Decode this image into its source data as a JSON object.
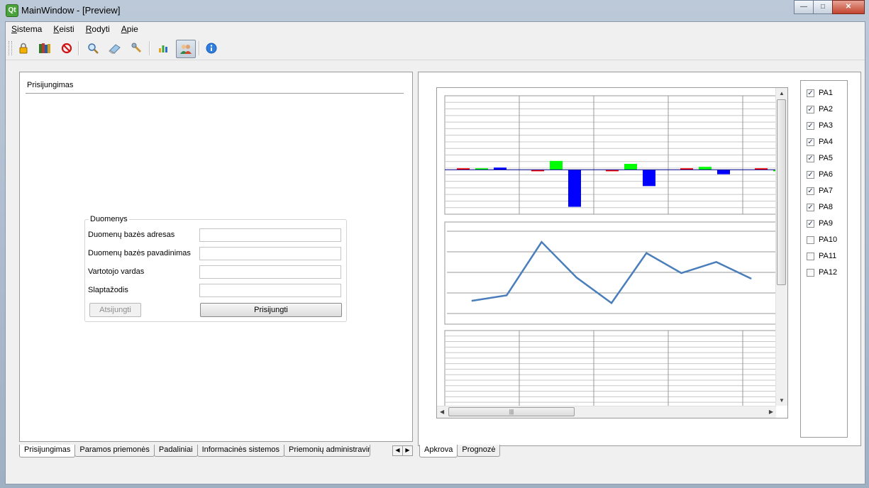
{
  "window": {
    "title": "MainWindow - [Preview]",
    "app_icon": "Qt"
  },
  "menubar": [
    {
      "label": "Sistema",
      "accel": "S",
      "rest": "istema"
    },
    {
      "label": "Keisti",
      "accel": "K",
      "rest": "eisti"
    },
    {
      "label": "Rodyti",
      "accel": "R",
      "rest": "odyti"
    },
    {
      "label": "Apie",
      "accel": "A",
      "rest": "pie"
    }
  ],
  "toolbar": {
    "icons": [
      "lock-icon",
      "books-icon",
      "stop-icon",
      "search-icon",
      "eraser-icon",
      "wrench-icon",
      "bar-chart-icon",
      "users-icon",
      "info-icon"
    ]
  },
  "login_panel": {
    "title": "Prisijungimas",
    "group_title": "Duomenys",
    "fields": [
      {
        "label": "Duomenų bazės adresas",
        "value": ""
      },
      {
        "label": "Duomenų bazės pavadinimas",
        "value": ""
      },
      {
        "label": "Vartotojo vardas",
        "value": ""
      },
      {
        "label": "Slaptažodis",
        "value": ""
      }
    ],
    "disconnect_label": "Atsijungti",
    "connect_label": "Prisijungti"
  },
  "left_tabs": [
    {
      "label": "Prisijungimas",
      "active": true
    },
    {
      "label": "Paramos priemonės",
      "active": false
    },
    {
      "label": "Padaliniai",
      "active": false
    },
    {
      "label": "Informacinės sistemos",
      "active": false
    },
    {
      "label": "Priemonių administravim",
      "active": false
    }
  ],
  "right_tabs": [
    {
      "label": "Apkrova",
      "active": true
    },
    {
      "label": "Prognozė",
      "active": false
    }
  ],
  "legend": [
    {
      "label": "PA1",
      "checked": true
    },
    {
      "label": "PA2",
      "checked": true
    },
    {
      "label": "PA3",
      "checked": true
    },
    {
      "label": "PA4",
      "checked": true
    },
    {
      "label": "PA5",
      "checked": true
    },
    {
      "label": "PA6",
      "checked": true
    },
    {
      "label": "PA7",
      "checked": true
    },
    {
      "label": "PA8",
      "checked": true
    },
    {
      "label": "PA9",
      "checked": true
    },
    {
      "label": "PA10",
      "checked": false
    },
    {
      "label": "PA11",
      "checked": false
    },
    {
      "label": "PA12",
      "checked": false
    }
  ],
  "colors": {
    "red": "#ff0000",
    "green": "#00ff00",
    "blue": "#0000ff",
    "line": "#4a7ebb"
  },
  "chart_data": [
    {
      "type": "bar",
      "categories": [
        "1",
        "2",
        "3",
        "4",
        "5"
      ],
      "series": [
        {
          "values": [
            0.1,
            -0.1,
            -0.1,
            0.1,
            0.1
          ]
        },
        {
          "values": [
            0.1,
            0.6,
            0.4,
            0.2,
            0
          ]
        },
        {
          "values": [
            0.15,
            -2.5,
            -1.1,
            -0.3,
            0
          ]
        }
      ],
      "ylim": [
        -3,
        5
      ],
      "grid": true
    },
    {
      "type": "line",
      "x": [
        1,
        2,
        3,
        4,
        5,
        6,
        7,
        8,
        9
      ],
      "series": [
        {
          "values": [
            0.45,
            0.7,
            3.1,
            1.5,
            0.35,
            2.6,
            1.7,
            2.2,
            1.45
          ]
        }
      ],
      "ylim": [
        -0.6,
        4
      ],
      "grid": true
    },
    {
      "type": "bar",
      "categories": [
        "1",
        "2",
        "3",
        "4",
        "5"
      ],
      "series": [
        {
          "values": [
            0,
            0,
            0,
            0,
            0
          ]
        },
        {
          "values": [
            0,
            0.55,
            0.25,
            0.05,
            0
          ]
        },
        {
          "values": [
            0.05,
            0,
            0,
            0,
            0
          ]
        }
      ],
      "ylim": [
        0,
        5
      ],
      "grid": true
    }
  ]
}
